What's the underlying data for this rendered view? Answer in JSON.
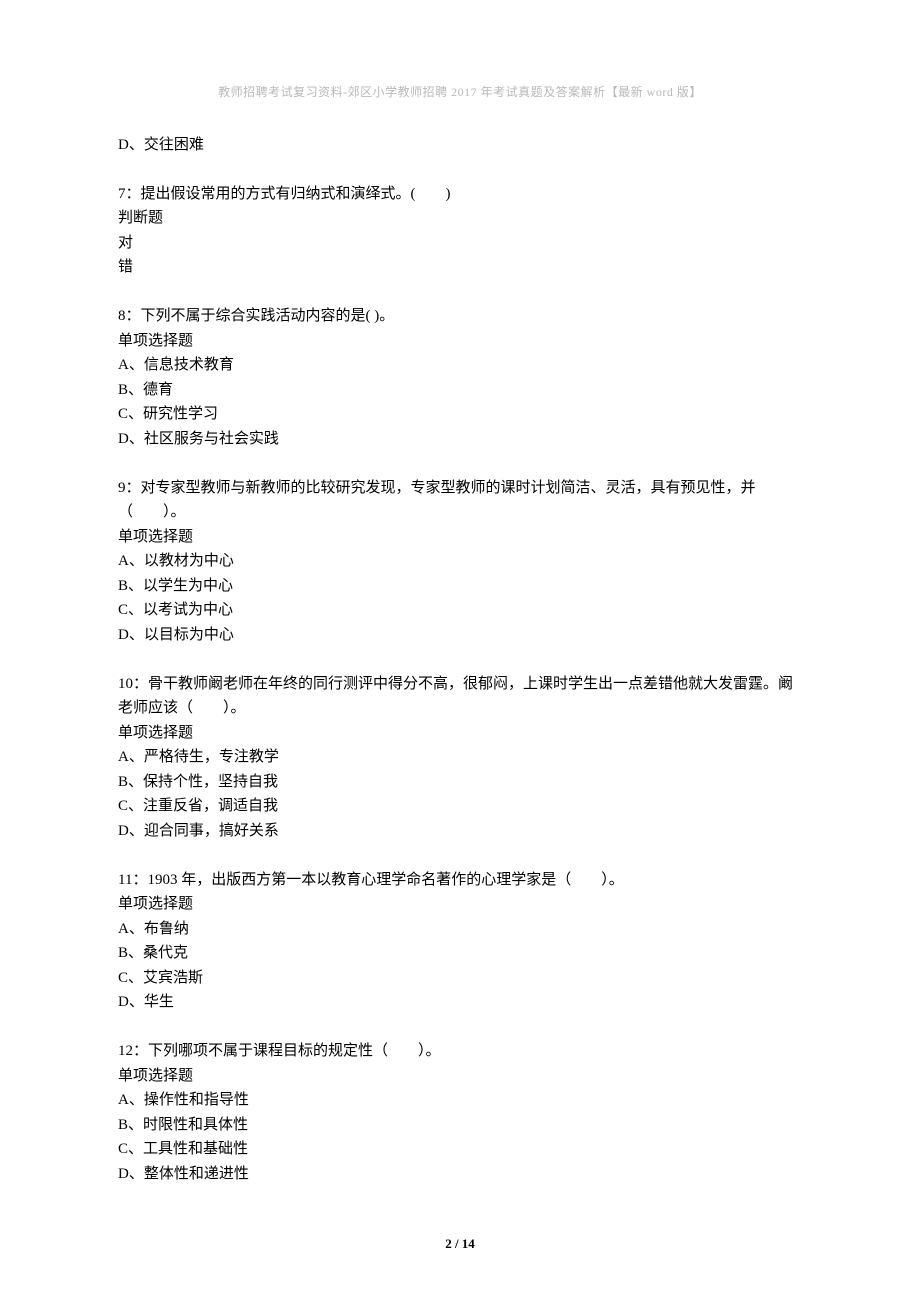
{
  "header": "教师招聘考试复习资料-郊区小学教师招聘 2017 年考试真题及答案解析【最新 word 版】",
  "q6": {
    "optD": "D、交往困难"
  },
  "q7": {
    "stem": "7：提出假设常用的方式有归纳式和演绎式。(　　)",
    "type": "判断题",
    "optA": "对",
    "optB": "错"
  },
  "q8": {
    "stem": "8：下列不属于综合实践活动内容的是( )。",
    "type": "单项选择题",
    "optA": "A、信息技术教育",
    "optB": "B、德育",
    "optC": "C、研究性学习",
    "optD": "D、社区服务与社会实践"
  },
  "q9": {
    "stem": "9：对专家型教师与新教师的比较研究发现，专家型教师的课时计划简洁、灵活，具有预见性，并（　　）。",
    "type": "单项选择题",
    "optA": "A、以教材为中心",
    "optB": "B、以学生为中心",
    "optC": "C、以考试为中心",
    "optD": "D、以目标为中心"
  },
  "q10": {
    "stem": "10：骨干教师阚老师在年终的同行测评中得分不高，很郁闷，上课时学生出一点差错他就大发雷霆。阚老师应该（　　）。",
    "type": "单项选择题",
    "optA": "A、严格待生，专注教学",
    "optB": "B、保持个性，坚持自我",
    "optC": "C、注重反省，调适自我",
    "optD": "D、迎合同事，搞好关系"
  },
  "q11": {
    "stem": "11：1903 年，出版西方第一本以教育心理学命名著作的心理学家是（　　）。",
    "type": "单项选择题",
    "optA": "A、布鲁纳",
    "optB": "B、桑代克",
    "optC": "C、艾宾浩斯",
    "optD": "D、华生"
  },
  "q12": {
    "stem": "12：下列哪项不属于课程目标的规定性（　　）。",
    "type": "单项选择题",
    "optA": "A、操作性和指导性",
    "optB": "B、时限性和具体性",
    "optC": "C、工具性和基础性",
    "optD": "D、整体性和递进性"
  },
  "footer": "2 / 14"
}
